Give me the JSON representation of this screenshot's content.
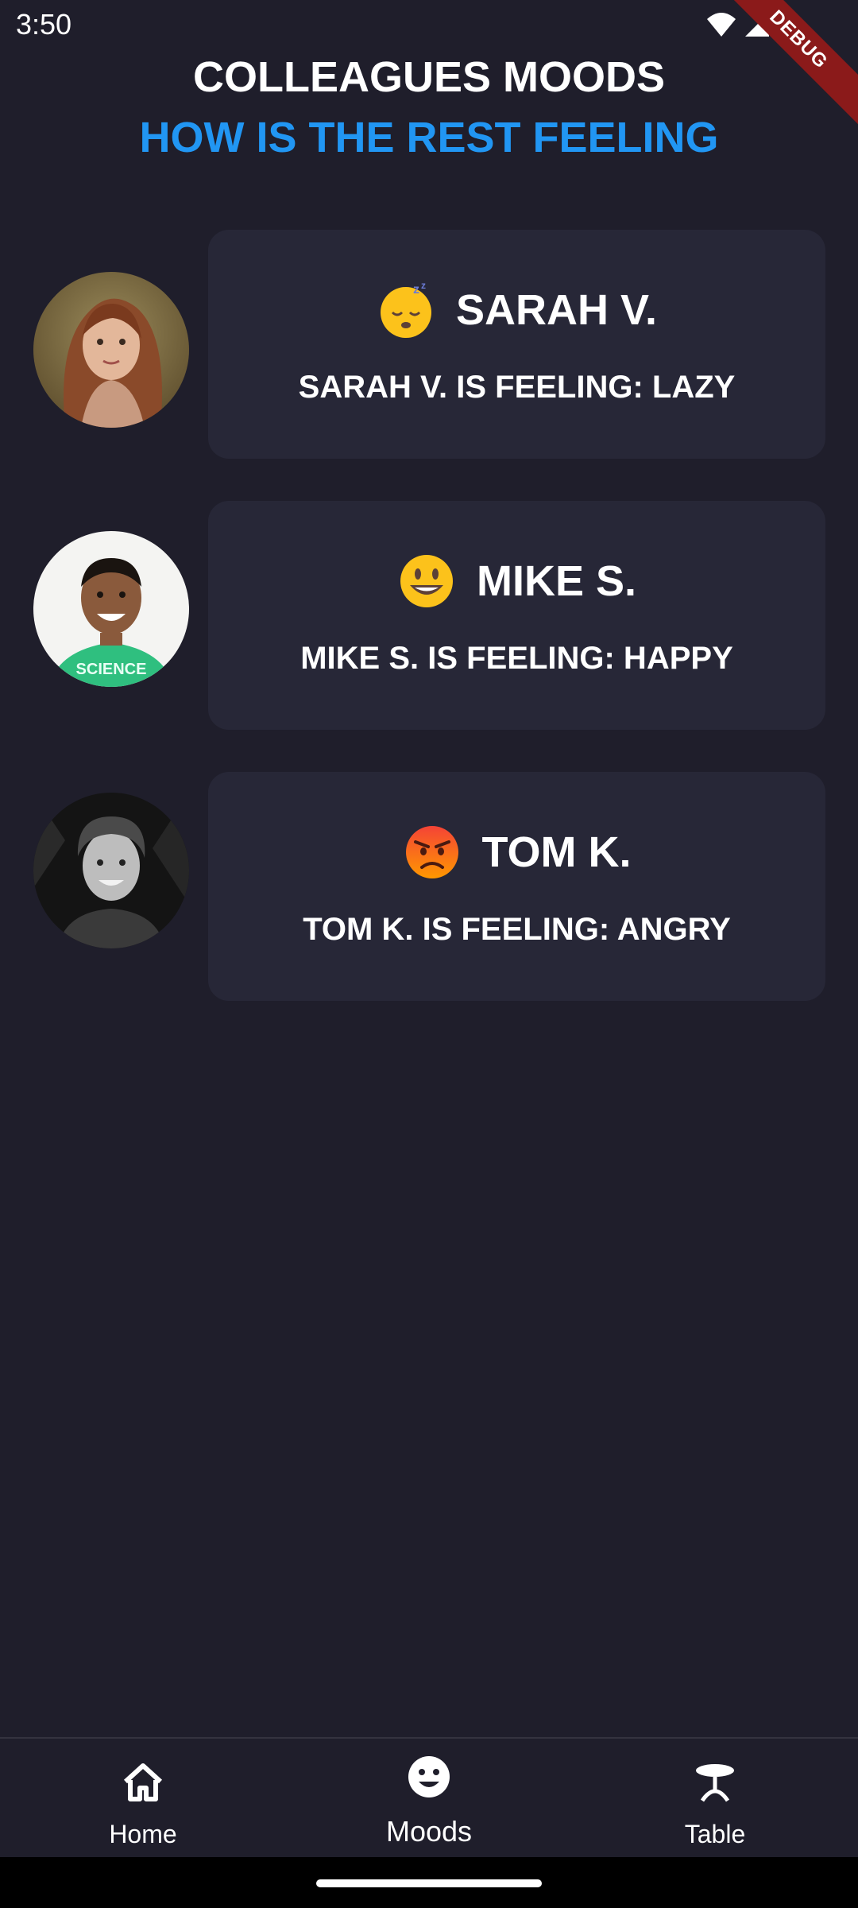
{
  "status_bar": {
    "time": "3:50",
    "debug_label": "DEBUG"
  },
  "header": {
    "title": "COLLEAGUES MOODS",
    "subtitle": "HOW IS THE REST FEELING",
    "subtitle_color": "#2196f3"
  },
  "moods": [
    {
      "name": "SARAH V.",
      "status": "SARAH V. IS FEELING: LAZY",
      "emoji_icon": "sleeping-face-icon"
    },
    {
      "name": "MIKE S.",
      "status": "MIKE S. IS FEELING: HAPPY",
      "emoji_icon": "smiling-face-icon"
    },
    {
      "name": "TOM K.",
      "status": "TOM K. IS FEELING: ANGRY",
      "emoji_icon": "angry-face-icon"
    }
  ],
  "bottom_nav": {
    "items": [
      {
        "label": "Home",
        "icon": "home-icon"
      },
      {
        "label": "Moods",
        "icon": "smiley-icon",
        "active": true
      },
      {
        "label": "Table",
        "icon": "table-icon"
      }
    ]
  },
  "colors": {
    "background": "#1f1e2b",
    "card": "#272737",
    "debug_banner": "#8b1a1a"
  }
}
